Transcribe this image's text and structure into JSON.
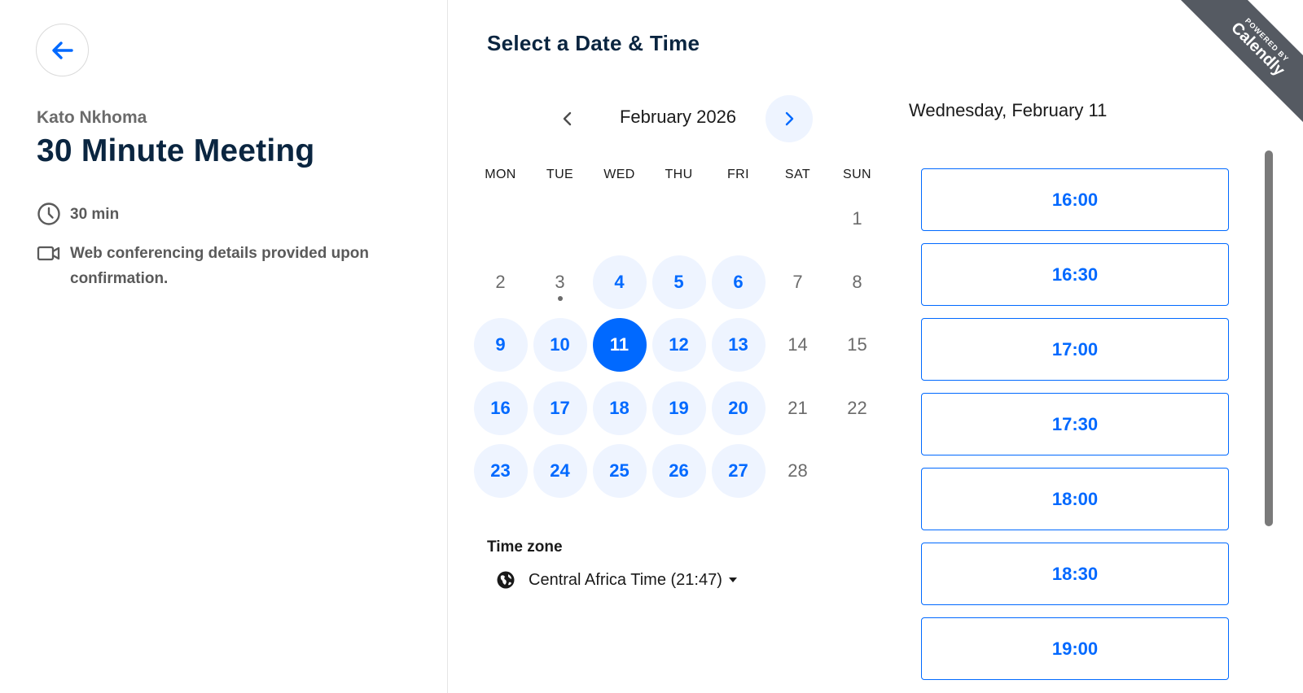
{
  "event": {
    "organizer": "Kato Nkhoma",
    "title": "30 Minute Meeting",
    "duration": "30 min",
    "conferencing": "Web conferencing details provided upon confirmation."
  },
  "calendar": {
    "heading": "Select a Date & Time",
    "month_label": "February 2026",
    "weekdays": [
      "MON",
      "TUE",
      "WED",
      "THU",
      "FRI",
      "SAT",
      "SUN"
    ],
    "days": [
      {
        "n": "1",
        "state": "unavailable"
      },
      {
        "n": "2",
        "state": "unavailable"
      },
      {
        "n": "3",
        "state": "today"
      },
      {
        "n": "4",
        "state": "available"
      },
      {
        "n": "5",
        "state": "available"
      },
      {
        "n": "6",
        "state": "available"
      },
      {
        "n": "7",
        "state": "unavailable"
      },
      {
        "n": "8",
        "state": "unavailable"
      },
      {
        "n": "9",
        "state": "available"
      },
      {
        "n": "10",
        "state": "available"
      },
      {
        "n": "11",
        "state": "selected"
      },
      {
        "n": "12",
        "state": "available"
      },
      {
        "n": "13",
        "state": "available"
      },
      {
        "n": "14",
        "state": "unavailable"
      },
      {
        "n": "15",
        "state": "unavailable"
      },
      {
        "n": "16",
        "state": "available"
      },
      {
        "n": "17",
        "state": "available"
      },
      {
        "n": "18",
        "state": "available"
      },
      {
        "n": "19",
        "state": "available"
      },
      {
        "n": "20",
        "state": "available"
      },
      {
        "n": "21",
        "state": "unavailable"
      },
      {
        "n": "22",
        "state": "unavailable"
      },
      {
        "n": "23",
        "state": "available"
      },
      {
        "n": "24",
        "state": "available"
      },
      {
        "n": "25",
        "state": "available"
      },
      {
        "n": "26",
        "state": "available"
      },
      {
        "n": "27",
        "state": "available"
      },
      {
        "n": "28",
        "state": "unavailable"
      }
    ],
    "timezone_label": "Time zone",
    "timezone_value": "Central Africa Time (21:47)"
  },
  "slots": {
    "date_heading": "Wednesday, February 11",
    "times": [
      "16:00",
      "16:30",
      "17:00",
      "17:30",
      "18:00",
      "18:30",
      "19:00"
    ]
  },
  "badge": {
    "small": "POWERED BY",
    "brand": "Calendly",
    "color": "#555a62"
  },
  "colors": {
    "accent": "#0069ff",
    "accent_light": "#eef4ff",
    "title": "#0a2540"
  },
  "icons": {
    "back": "arrow-left-icon",
    "duration": "clock-icon",
    "conferencing": "video-camera-icon",
    "prev": "chevron-left-icon",
    "next": "chevron-right-icon",
    "timezone": "globe-icon"
  }
}
